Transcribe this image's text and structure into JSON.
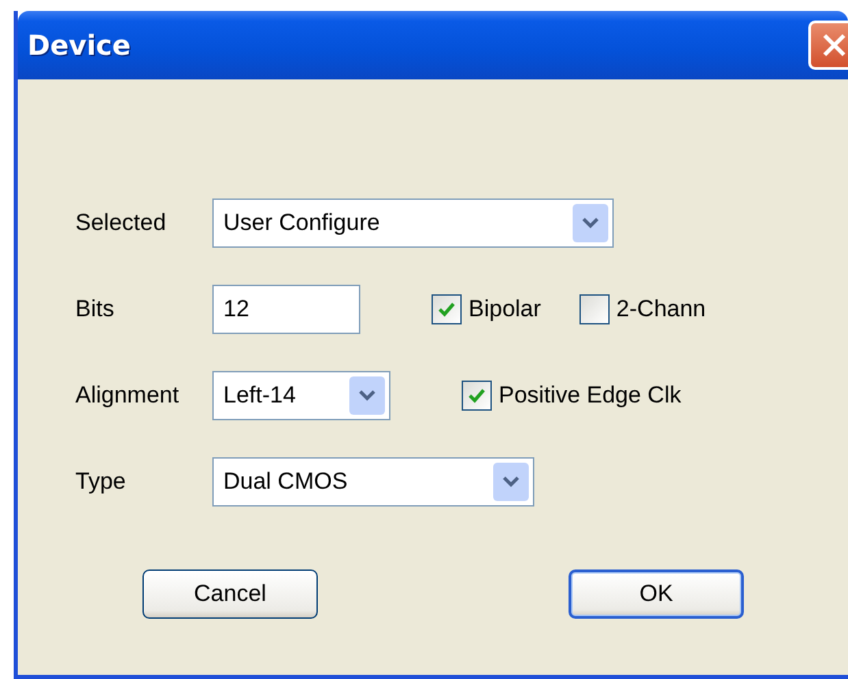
{
  "window": {
    "title": "Device"
  },
  "rows": [
    {
      "label": "Selected",
      "kind": "combo",
      "value": "User Configure"
    },
    {
      "label": "Bits",
      "kind": "text",
      "value": "12",
      "checkboxes": [
        {
          "label": "Bipolar",
          "checked": true
        },
        {
          "label": "2-Chann",
          "checked": false
        }
      ]
    },
    {
      "label": "Alignment",
      "kind": "combo",
      "value": "Left-14",
      "checkboxes": [
        {
          "label": "Positive Edge Clk",
          "checked": true
        }
      ]
    },
    {
      "label": "Type",
      "kind": "combo",
      "value": "Dual CMOS"
    }
  ],
  "buttons": [
    {
      "label": "Cancel",
      "default": false
    },
    {
      "label": "OK",
      "default": true
    }
  ]
}
